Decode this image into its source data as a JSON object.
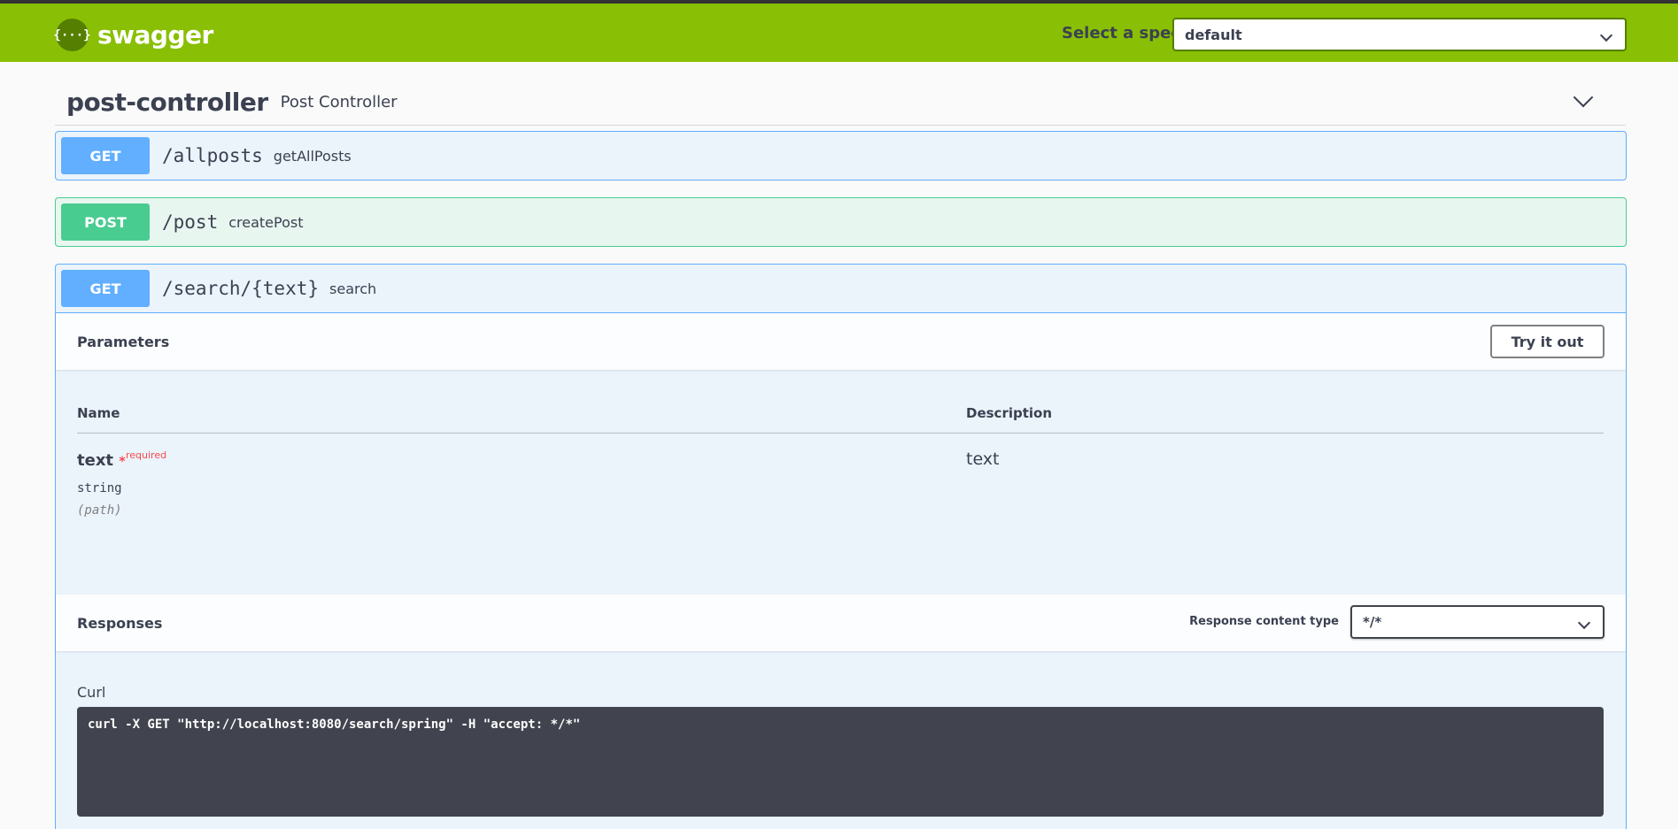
{
  "header": {
    "logo_glyph": "{···}",
    "logo_text": "swagger",
    "spec_label": "Select a spec",
    "spec_value": "default"
  },
  "tag": {
    "name": "post-controller",
    "description": "Post Controller"
  },
  "operations": [
    {
      "method": "GET",
      "path": "/allposts",
      "summary": "getAllPosts"
    },
    {
      "method": "POST",
      "path": "/post",
      "summary": "createPost"
    },
    {
      "method": "GET",
      "path": "/search/{text}",
      "summary": "search"
    }
  ],
  "expanded": {
    "parameters_title": "Parameters",
    "try_button": "Try it out",
    "col_name": "Name",
    "col_description": "Description",
    "param": {
      "name": "text",
      "star": "*",
      "required": "required",
      "type": "string",
      "in": "(path)",
      "description": "text"
    },
    "responses_title": "Responses",
    "response_content_type_label": "Response content type",
    "response_content_type_value": "*/*",
    "curl_label": "Curl",
    "curl_command": "curl -X GET \"http://localhost:8080/search/spring\" -H \"accept: */*\""
  },
  "colors": {
    "topbar": "#89bf04",
    "get": "#61affe",
    "post": "#49cc90",
    "code_bg": "#41444e"
  }
}
